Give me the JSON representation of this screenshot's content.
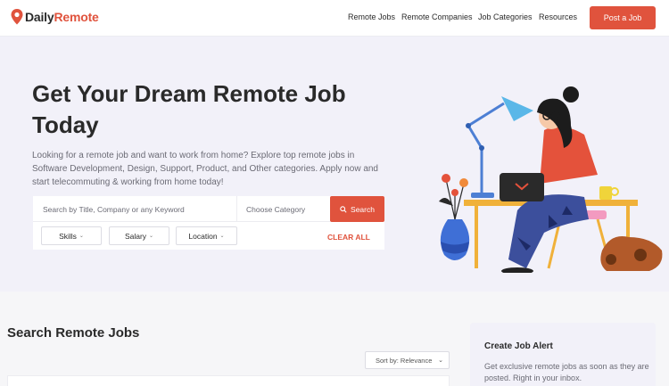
{
  "brand": {
    "name_part1": "Daily",
    "name_part2": "Remote",
    "accent": "#e0533d"
  },
  "nav": {
    "items": [
      {
        "label": "Remote Jobs"
      },
      {
        "label": "Remote Companies"
      },
      {
        "label": "Job Categories"
      },
      {
        "label": "Resources"
      }
    ],
    "post_button": "Post a Job"
  },
  "hero": {
    "title": "Get Your Dream Remote Job Today",
    "description": "Looking for a remote job and want to work from home? Explore top remote jobs in Software Development, Design, Support, Product, and Other categories. Apply now and start telecommuting & working from home today!",
    "search": {
      "placeholder": "Search by Title, Company or any Keyword",
      "category_placeholder": "Choose Category",
      "button": "Search"
    },
    "filters": [
      {
        "label": "Skills"
      },
      {
        "label": "Salary"
      },
      {
        "label": "Location"
      }
    ],
    "clear_all": "CLEAR ALL"
  },
  "jobs": {
    "title": "Search Remote Jobs",
    "sort_label": "Sort by: Relevance"
  },
  "alert": {
    "title": "Create Job Alert",
    "description": "Get exclusive remote jobs as soon as they are posted. Right in your inbox."
  }
}
